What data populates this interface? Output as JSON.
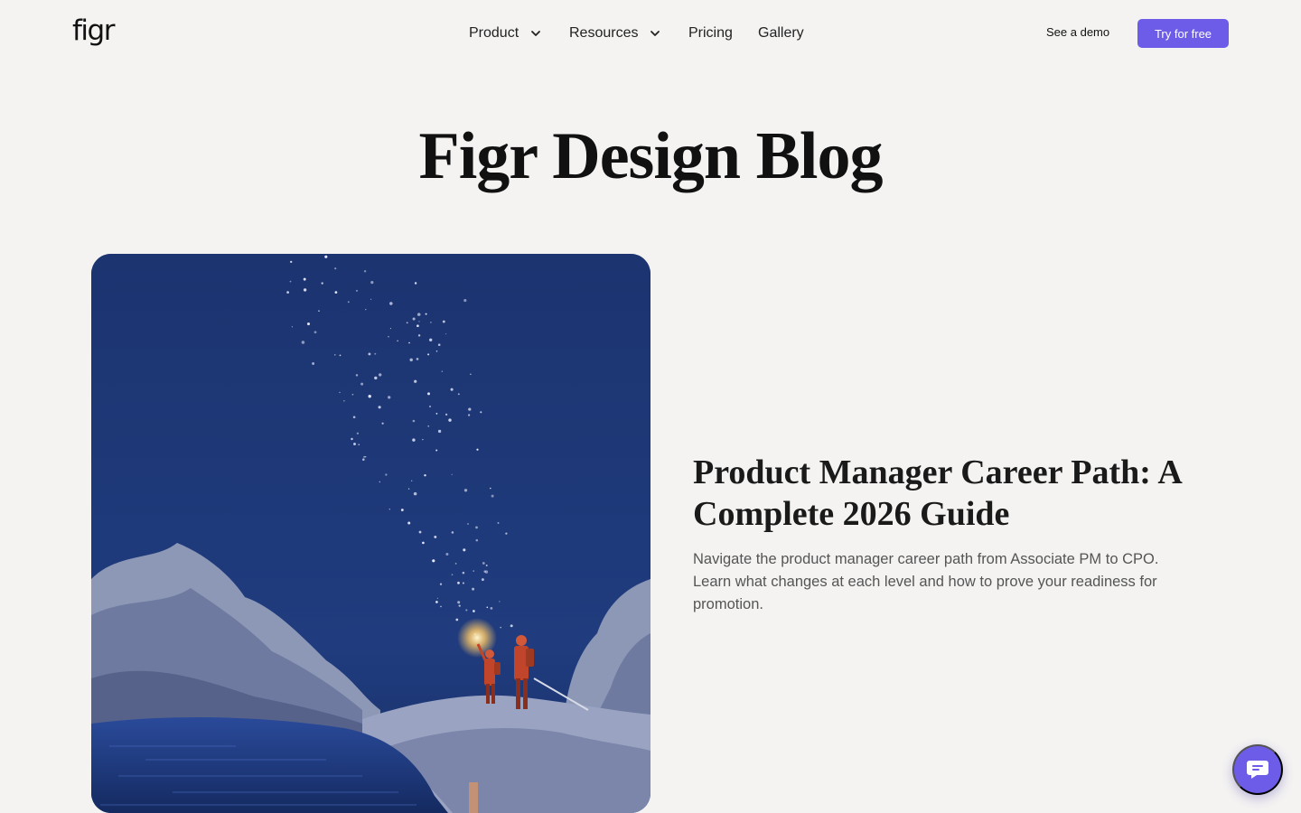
{
  "header": {
    "logo": "figr",
    "nav": [
      {
        "label": "Product",
        "icon": "chevron-down-icon"
      },
      {
        "label": "Resources",
        "icon": "chevron-down-icon"
      },
      {
        "label": "Pricing"
      },
      {
        "label": "Gallery"
      }
    ],
    "demo_label": "See a demo",
    "cta_label": "Try for free"
  },
  "hero": {
    "title": "Figr Design Blog"
  },
  "featured_post": {
    "title": "Product Manager Career Path: A Complete 2026 Guide",
    "excerpt": "Navigate the product manager career path from Associate PM to CPO. Learn what changes at each level and how to prove your readiness for promotion.",
    "image_icon": "night-sky-illustration"
  },
  "chat": {
    "icon": "chat-icon"
  },
  "colors": {
    "accent": "#6c5ce7",
    "background": "#f4f3f2",
    "night_sky": "#1f3978"
  }
}
